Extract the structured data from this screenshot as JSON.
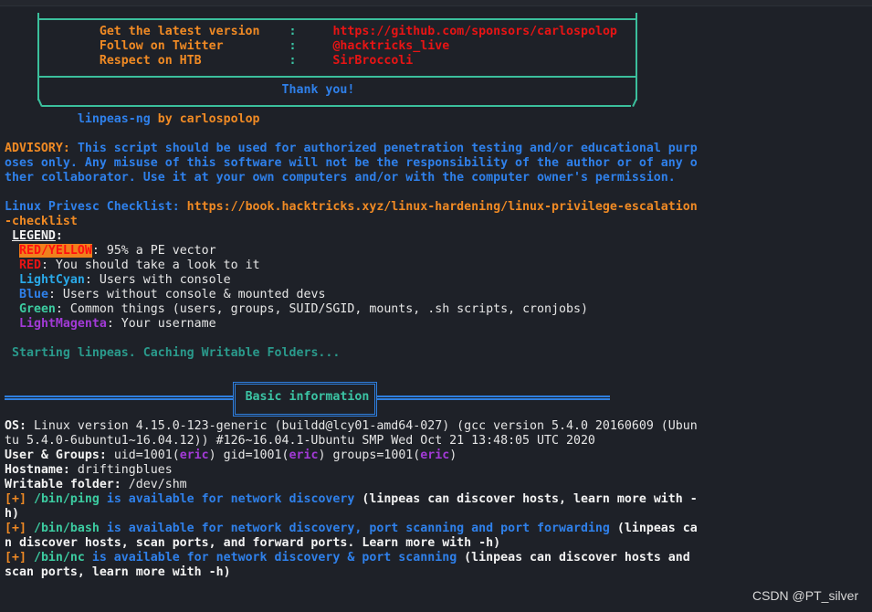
{
  "terminal": {
    "lines": [
      [
        {
          "t": "             ",
          "c": "plain"
        },
        {
          "t": "Get the latest version",
          "c": "orange"
        },
        {
          "t": "    ",
          "c": "plain"
        },
        {
          "t": ":",
          "c": "teal"
        },
        {
          "t": "     ",
          "c": "plain"
        },
        {
          "t": "https://github.com/sponsors/carlospolop",
          "c": "red"
        }
      ],
      [
        {
          "t": "             ",
          "c": "plain"
        },
        {
          "t": "Follow on Twitter",
          "c": "orange"
        },
        {
          "t": "         ",
          "c": "plain"
        },
        {
          "t": ":",
          "c": "teal"
        },
        {
          "t": "     ",
          "c": "plain"
        },
        {
          "t": "@hacktricks_live",
          "c": "red"
        }
      ],
      [
        {
          "t": "             ",
          "c": "plain"
        },
        {
          "t": "Respect on HTB",
          "c": "orange"
        },
        {
          "t": "            ",
          "c": "plain"
        },
        {
          "t": ":",
          "c": "teal"
        },
        {
          "t": "     ",
          "c": "plain"
        },
        {
          "t": "SirBroccoli",
          "c": "red"
        }
      ],
      [],
      [
        {
          "t": "                                      ",
          "c": "plain"
        },
        {
          "t": "Thank you!",
          "c": "blue"
        }
      ],
      [],
      [
        {
          "t": "          ",
          "c": "plain"
        },
        {
          "t": "linpeas-ng",
          "c": "blue"
        },
        {
          "t": " by carlospolop",
          "c": "orange"
        }
      ],
      [],
      [
        {
          "t": "ADVISORY: ",
          "c": "orange"
        },
        {
          "t": "This script should be used for authorized penetration testing and/or educational purp",
          "c": "blue"
        }
      ],
      [
        {
          "t": "oses only. Any misuse of this software will not be the responsibility of the author or of any o",
          "c": "blue"
        }
      ],
      [
        {
          "t": "ther collaborator. Use it at your own computers and/or with the computer owner's permission.",
          "c": "blue"
        }
      ],
      [],
      [
        {
          "t": "Linux Privesc Checklist: ",
          "c": "blue"
        },
        {
          "t": "https://book.hacktricks.xyz/linux-hardening/linux-privilege-escalation",
          "c": "orange"
        }
      ],
      [
        {
          "t": "-checklist",
          "c": "orange"
        }
      ],
      [
        {
          "t": " ",
          "c": "plain"
        },
        {
          "t": "LEGEND",
          "c": "white ul"
        },
        {
          "t": ":",
          "c": "white"
        }
      ],
      [
        {
          "t": "  ",
          "c": "plain"
        },
        {
          "t": "RED/YELLOW",
          "c": "hl"
        },
        {
          "t": ": 95% a PE vector",
          "c": "plain"
        }
      ],
      [
        {
          "t": "  ",
          "c": "plain"
        },
        {
          "t": "RED",
          "c": "red"
        },
        {
          "t": ": You should take a look to it",
          "c": "plain"
        }
      ],
      [
        {
          "t": "  ",
          "c": "plain"
        },
        {
          "t": "LightCyan",
          "c": "cyan"
        },
        {
          "t": ": Users with console",
          "c": "plain"
        }
      ],
      [
        {
          "t": "  ",
          "c": "plain"
        },
        {
          "t": "Blue",
          "c": "blue"
        },
        {
          "t": ": Users without console & mounted devs",
          "c": "plain"
        }
      ],
      [
        {
          "t": "  ",
          "c": "plain"
        },
        {
          "t": "Green",
          "c": "green"
        },
        {
          "t": ": Common things (users, groups, SUID/SGID, mounts, .sh scripts, cronjobs)",
          "c": "plain"
        }
      ],
      [
        {
          "t": "  ",
          "c": "plain"
        },
        {
          "t": "LightMagenta",
          "c": "magenta"
        },
        {
          "t": ": Your username",
          "c": "plain"
        }
      ],
      [],
      [
        {
          "t": " ",
          "c": "plain"
        },
        {
          "t": "Starting linpeas. Caching Writable Folders...",
          "c": "dteal"
        }
      ],
      [],
      [],
      [
        {
          "t": "                                 ",
          "c": "plain"
        },
        {
          "t": "Basic information",
          "c": "teal"
        }
      ],
      [],
      [
        {
          "t": "OS: ",
          "c": "white"
        },
        {
          "t": "Linux version 4.15.0-123-generic (buildd@lcy01-amd64-027) (gcc version 5.4.0 20160609 (Ubun",
          "c": "plain"
        }
      ],
      [
        {
          "t": "tu 5.4.0-6ubuntu1~16.04.12)) #126~16.04.1-Ubuntu SMP Wed Oct 21 13:48:05 UTC 2020",
          "c": "plain"
        }
      ],
      [
        {
          "t": "User & Groups: ",
          "c": "white"
        },
        {
          "t": "uid=1001(",
          "c": "plain"
        },
        {
          "t": "eric",
          "c": "magenta"
        },
        {
          "t": ") gid=1001(",
          "c": "plain"
        },
        {
          "t": "eric",
          "c": "magenta"
        },
        {
          "t": ") groups=1001(",
          "c": "plain"
        },
        {
          "t": "eric",
          "c": "magenta"
        },
        {
          "t": ")",
          "c": "plain"
        }
      ],
      [
        {
          "t": "Hostname: ",
          "c": "white"
        },
        {
          "t": "driftingblues",
          "c": "plain"
        }
      ],
      [
        {
          "t": "Writable folder: ",
          "c": "white"
        },
        {
          "t": "/dev/shm",
          "c": "plain"
        }
      ],
      [
        {
          "t": "[+] ",
          "c": "orange"
        },
        {
          "t": "/bin/ping",
          "c": "green"
        },
        {
          "t": " is available for network discovery",
          "c": "blue"
        },
        {
          "t": " (linpeas can discover hosts, learn more with -",
          "c": "white"
        }
      ],
      [
        {
          "t": "h)",
          "c": "white"
        }
      ],
      [
        {
          "t": "[+] ",
          "c": "orange"
        },
        {
          "t": "/bin/bash",
          "c": "green"
        },
        {
          "t": " is available for network discovery, port scanning and port forwarding",
          "c": "blue"
        },
        {
          "t": " (linpeas ca",
          "c": "white"
        }
      ],
      [
        {
          "t": "n discover hosts, scan ports, and forward ports. Learn more with -h)",
          "c": "white"
        }
      ],
      [
        {
          "t": "[+] ",
          "c": "orange"
        },
        {
          "t": "/bin/nc",
          "c": "green"
        },
        {
          "t": " is available for network discovery & port scanning",
          "c": "blue"
        },
        {
          "t": " (linpeas can discover hosts and",
          "c": "white"
        }
      ],
      [
        {
          "t": "scan ports, learn more with -h)",
          "c": "white"
        }
      ]
    ]
  },
  "watermark": "CSDN @PT_silver",
  "colors": {
    "background": "#1e2128",
    "orange": "#f08a24",
    "red": "#e81414",
    "blue": "#2f80ea",
    "teal": "#3bc4a4",
    "magenta": "#a23ad6"
  }
}
